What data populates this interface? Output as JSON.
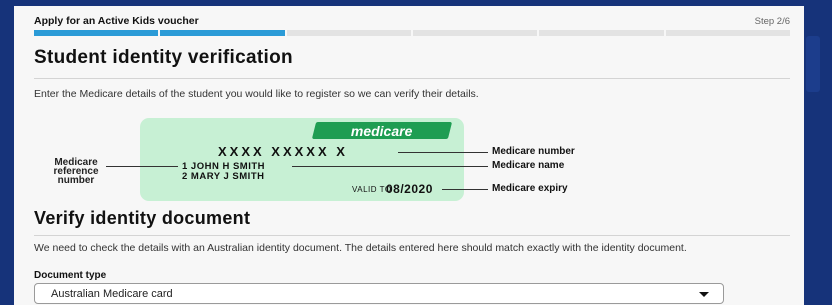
{
  "header": {
    "title": "Apply for an Active Kids voucher",
    "step": "Step 2/6",
    "progress": {
      "total_steps": 6,
      "completed_steps": 2
    }
  },
  "student_section": {
    "heading": "Student identity verification",
    "intro": "Enter the Medicare details of the student you would like to register so we can verify their details."
  },
  "medicare_card": {
    "brand": "medicare",
    "number": "XXXX XXXXX X",
    "names": [
      "1 JOHN H SMITH",
      "2 MARY J SMITH"
    ],
    "valid_label": "VALID TO",
    "valid_date": "08/2020",
    "reference_label": "Medicare reference number",
    "callouts": {
      "number": "Medicare number",
      "name": "Medicare name",
      "expiry": "Medicare expiry"
    }
  },
  "verify_section": {
    "heading": "Verify identity document",
    "description": "We need to check the details with an Australian identity document. The details entered here should match exactly with the identity document.",
    "document_type_label": "Document type",
    "document_type_value": "Australian Medicare card"
  },
  "colors": {
    "page_bg": "#16337a",
    "progress_active": "#2b9bd7",
    "card_bg": "#c7f0d4",
    "medicare_badge": "#1e9d52"
  }
}
